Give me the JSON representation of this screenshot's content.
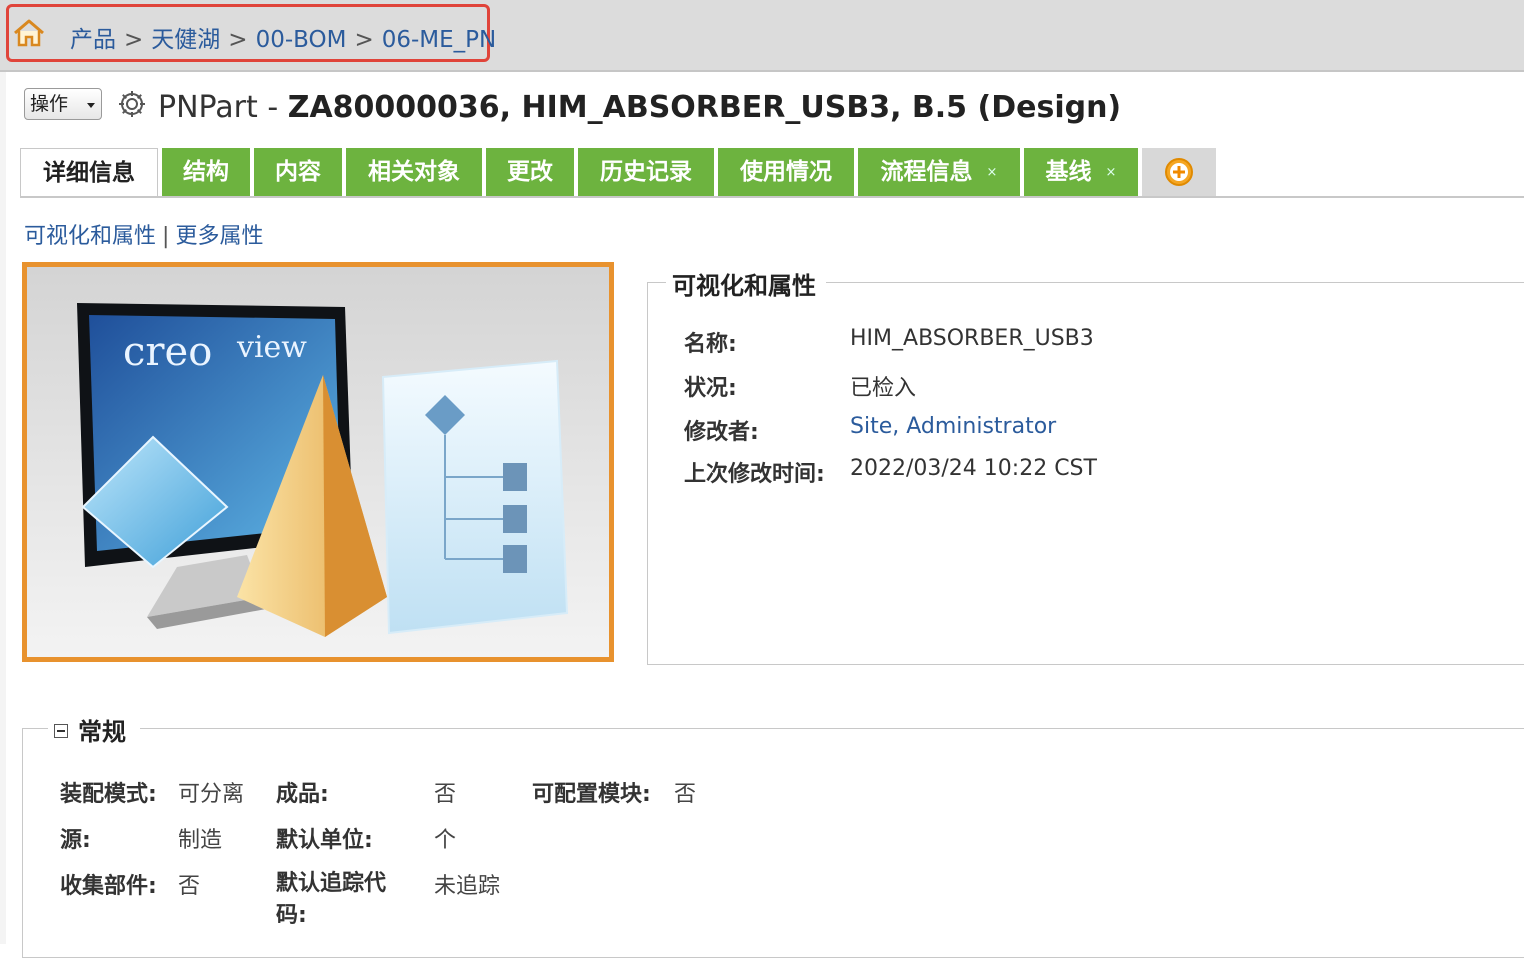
{
  "breadcrumb": {
    "items": [
      "产品",
      "天健湖",
      "00-BOM",
      "06-ME_PN"
    ],
    "separator": ">"
  },
  "header": {
    "actions_label": "操作",
    "object_type": "PNPart",
    "dash": "-",
    "object_identity": "ZA80000036, HIM_ABSORBER_USB3, B.5 (Design)"
  },
  "tabs": [
    {
      "label": "详细信息",
      "active": true
    },
    {
      "label": "结构"
    },
    {
      "label": "内容"
    },
    {
      "label": "相关对象"
    },
    {
      "label": "更改"
    },
    {
      "label": "历史记录"
    },
    {
      "label": "使用情况"
    },
    {
      "label": "流程信息",
      "closable": true
    },
    {
      "label": "基线",
      "closable": true
    }
  ],
  "tab_close_glyph": "×",
  "sublinks": {
    "visualization": "可视化和属性",
    "separator": "|",
    "more": "更多属性"
  },
  "thumbnail": {
    "brand_text": "creo view"
  },
  "visualization_panel": {
    "title": "可视化和属性",
    "rows": [
      {
        "label": "名称:",
        "value": "HIM_ABSORBER_USB3"
      },
      {
        "label": "状况:",
        "value": "已检入"
      },
      {
        "label": "修改者:",
        "value": "Site, Administrator"
      },
      {
        "label": "上次修改时间:",
        "value": "2022/03/24 10:22 CST"
      }
    ]
  },
  "general": {
    "title": "常规",
    "assembly_mode": {
      "label": "装配模式:",
      "value": "可分离"
    },
    "source": {
      "label": "源:",
      "value": "制造"
    },
    "gathering_part": {
      "label": "收集部件:",
      "value": "否"
    },
    "end_item": {
      "label": "成品:",
      "value": "否"
    },
    "default_unit": {
      "label": "默认单位:",
      "value": "个"
    },
    "default_trace_code": {
      "label": "默认追踪代码:",
      "value": "未追踪"
    },
    "configurable_module": {
      "label": "可配置模块:",
      "value": "否"
    }
  },
  "colors": {
    "tab_green": "#6db33f",
    "link_blue": "#2b5b9c",
    "highlight_red": "#e0443a",
    "thumb_border": "#e8922e"
  }
}
